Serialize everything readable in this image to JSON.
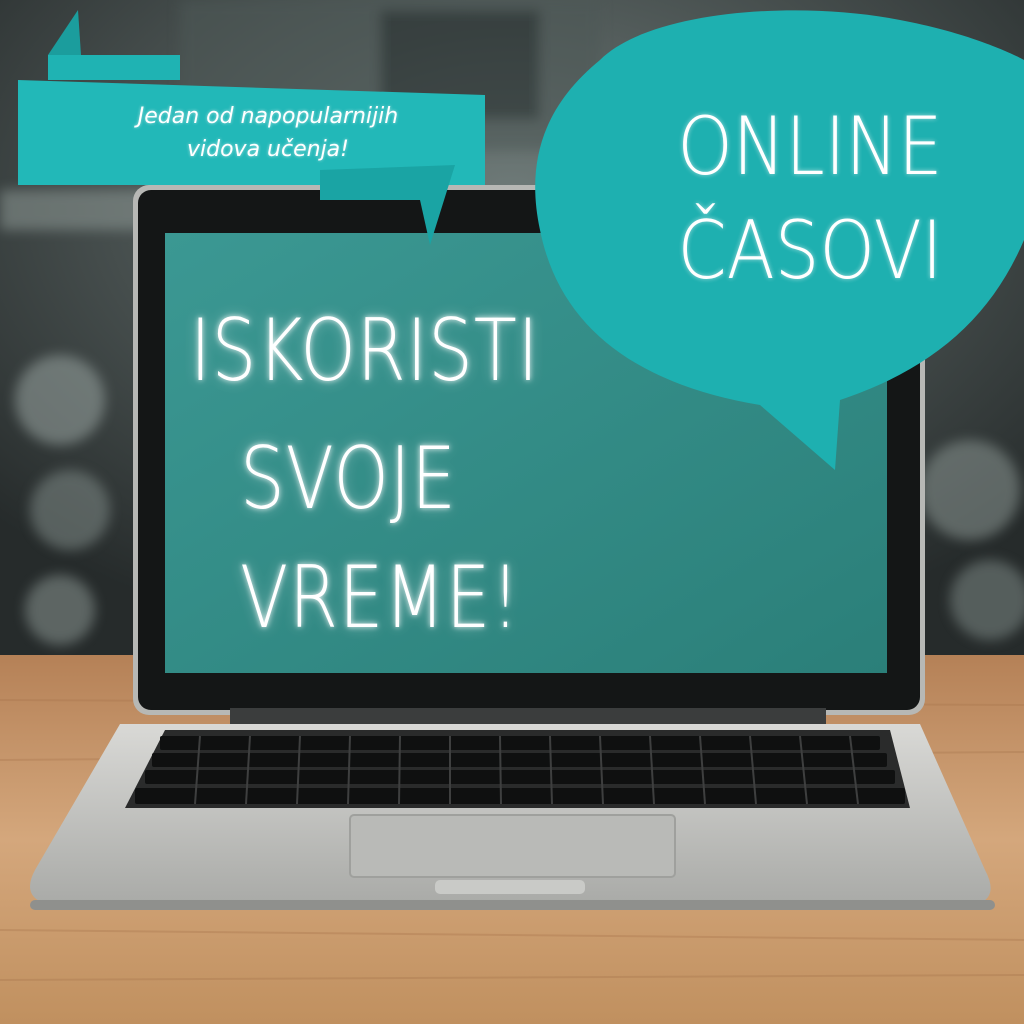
{
  "banner": {
    "line1": "Jedan od napopularnijih",
    "line2": "vidova učenja!"
  },
  "bubble": {
    "line1": "ONLINE",
    "line2": "ČASOVI"
  },
  "screen": {
    "line1": "ISKORISTI",
    "line2": "SVOJE",
    "line3": "VREME!"
  },
  "colors": {
    "accent": "#1fb3b3",
    "screen": "#2e8a84",
    "desk": "#c8996b"
  }
}
